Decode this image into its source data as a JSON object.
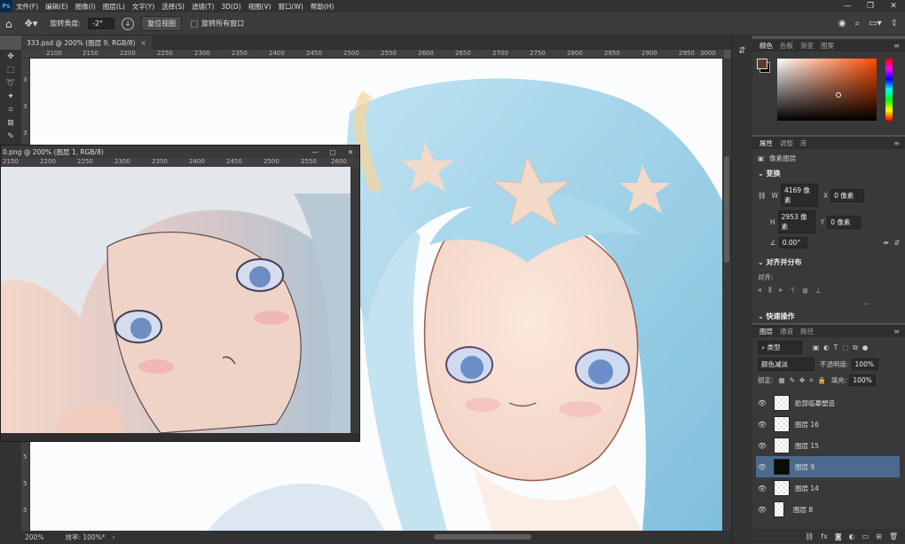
{
  "app": {
    "logo": "Ps"
  },
  "menu": [
    "文件(F)",
    "编辑(E)",
    "图像(I)",
    "图层(L)",
    "文字(Y)",
    "选择(S)",
    "滤镜(T)",
    "3D(D)",
    "视图(V)",
    "窗口(W)",
    "帮助(H)"
  ],
  "options": {
    "rotate_label": "旋转角度:",
    "rotate_value": "-2°",
    "reset_view": "复位视图",
    "rotate_all": "旋转所有窗口"
  },
  "document_tab": {
    "title": "333.psd @ 200% (图层 9, RGB/8)",
    "close": "×"
  },
  "ruler_top": [
    "2100",
    "2150",
    "2200",
    "2250",
    "2300",
    "2350",
    "2400",
    "2450",
    "2500",
    "2550",
    "2600",
    "2650",
    "2700",
    "2750",
    "2800",
    "2850",
    "2900",
    "2950",
    "3000"
  ],
  "ruler_left": [
    "3",
    "3",
    "3",
    "3",
    "3",
    "3",
    "4",
    "4",
    "4",
    "4",
    "4",
    "4",
    "4",
    "4",
    "5",
    "5",
    "5"
  ],
  "status": {
    "zoom": "200%",
    "doc": "效率: 100%*"
  },
  "float_window": {
    "title": "0.png @ 200% (图层 1, RGB/8)",
    "ruler": [
      "2150",
      "2200",
      "2250",
      "2300",
      "2350",
      "2400",
      "2450",
      "2500",
      "2550",
      "2600"
    ]
  },
  "color_panel": {
    "tabs": [
      "颜色",
      "色板",
      "渐变",
      "图案"
    ],
    "foreground": "#5a3a2c",
    "background": "#000000"
  },
  "properties_panel": {
    "tabs": [
      "属性",
      "调整",
      "库"
    ],
    "kind": "像素图层",
    "transform": {
      "title": "变换",
      "w_label": "W",
      "w": "4169 像素",
      "x_label": "X",
      "x": "0 像素",
      "h_label": "H",
      "h": "2953 像素",
      "y_label": "Y",
      "y": "0 像素",
      "angle": "0.00°"
    },
    "align": {
      "title": "对齐并分布",
      "label": "对齐:",
      "more": "..."
    },
    "quick": {
      "title": "快速操作"
    }
  },
  "layers_panel": {
    "tabs": [
      "图层",
      "通道",
      "路径"
    ],
    "filter": "类型",
    "blend": "颜色减淡",
    "opacity_label": "不透明度:",
    "opacity": "100%",
    "lock_label": "锁定:",
    "fill_label": "填充:",
    "fill": "100%",
    "layers": [
      {
        "name": "脸部临摹塑造",
        "selected": false
      },
      {
        "name": "图层 16",
        "selected": false
      },
      {
        "name": "图层 15",
        "selected": false
      },
      {
        "name": "图层 9",
        "selected": true
      },
      {
        "name": "图层 14",
        "selected": false
      },
      {
        "name": "图层 8",
        "selected": false
      }
    ],
    "bottom_icons": "fx"
  }
}
